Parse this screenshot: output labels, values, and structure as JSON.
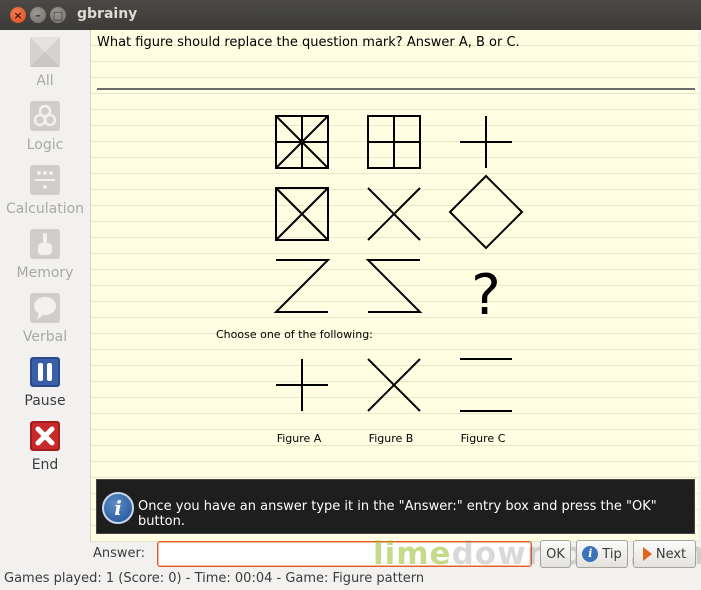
{
  "window": {
    "title": "gbrainy"
  },
  "sidebar": {
    "items": [
      {
        "label": "All",
        "icon": "all-games-icon",
        "active": false
      },
      {
        "label": "Logic",
        "icon": "logic-icon",
        "active": false
      },
      {
        "label": "Calculation",
        "icon": "calculation-icon",
        "active": false
      },
      {
        "label": "Memory",
        "icon": "memory-icon",
        "active": false
      },
      {
        "label": "Verbal",
        "icon": "verbal-icon",
        "active": false
      },
      {
        "label": "Pause",
        "icon": "pause-icon",
        "active": true
      },
      {
        "label": "End",
        "icon": "end-icon",
        "active": true
      }
    ]
  },
  "puzzle": {
    "question": "What figure should replace the question mark? Answer A, B or C.",
    "unknown": "?",
    "choose_prompt": "Choose one of the following:",
    "options": [
      "Figure A",
      "Figure B",
      "Figure C"
    ]
  },
  "info": {
    "icon_glyph": "i",
    "message": "Once you have an answer type it in the \"Answer:\" entry box and press the \"OK\" button."
  },
  "answer": {
    "label": "Answer:",
    "value": "",
    "ok_label": "OK",
    "tip_label": "Tip",
    "next_label": "Next"
  },
  "watermark": {
    "lime": "lime",
    "rest": "download.com"
  },
  "status": {
    "text": "Games played: 1 (Score: 0) - Time: 00:04 - Game: Figure pattern"
  }
}
